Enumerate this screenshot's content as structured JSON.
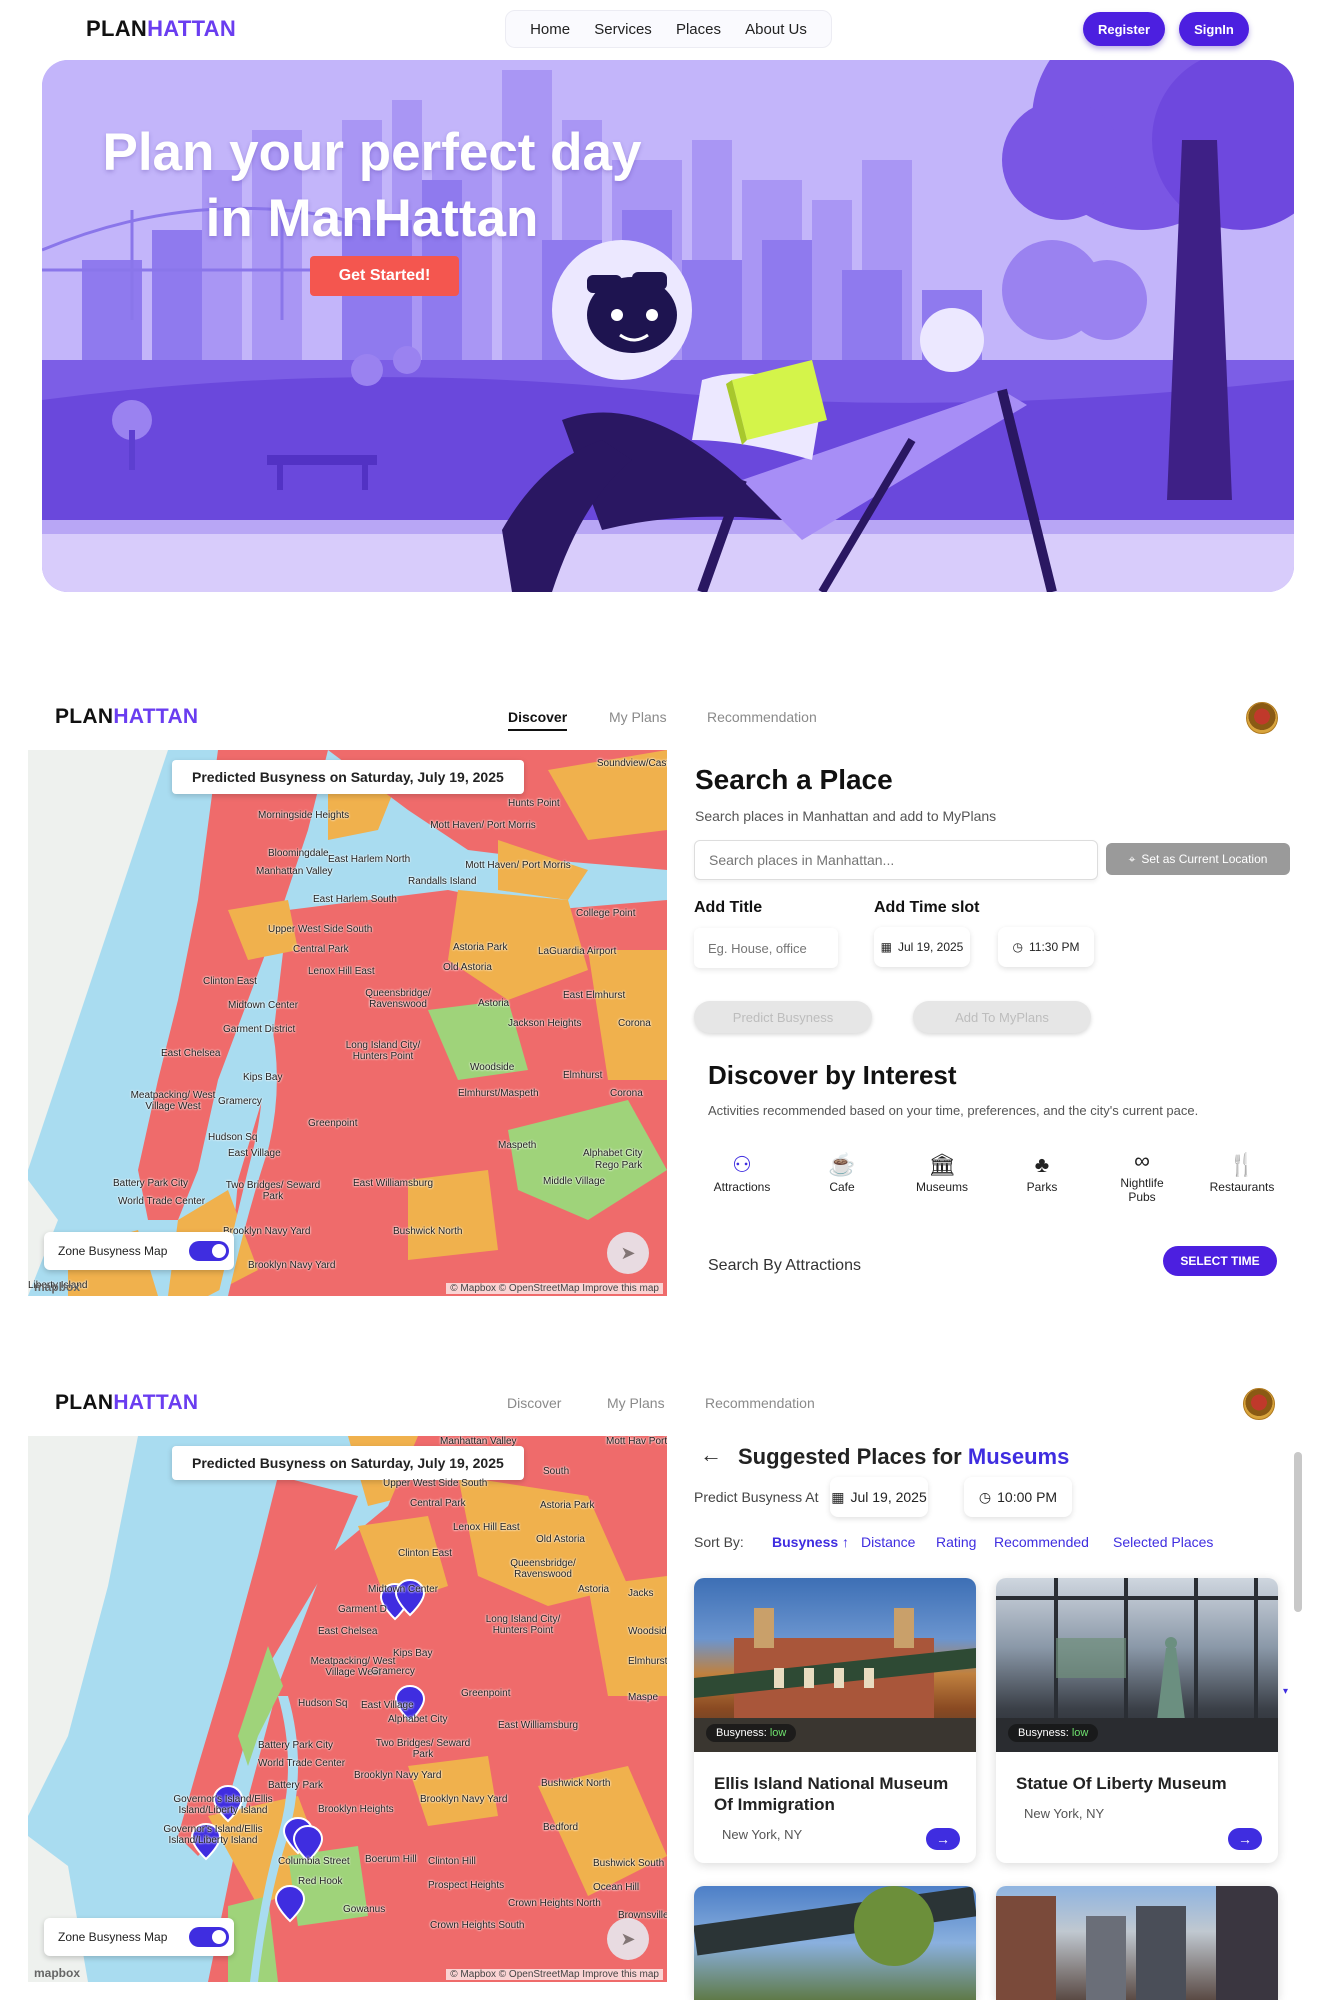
{
  "landing": {
    "logo_a": "PLAN",
    "logo_b": "HATTAN",
    "nav": [
      "Home",
      "Services",
      "Places",
      "About Us"
    ],
    "register": "Register",
    "signin": "SignIn",
    "hero_title": "Plan your perfect day in ManHattan",
    "cta": "Get Started!"
  },
  "app": {
    "logo_a": "PLAN",
    "logo_b": "HATTAN",
    "tabs": [
      "Discover",
      "My Plans",
      "Recommendation"
    ]
  },
  "map": {
    "predicted": "Predicted Busyness on Saturday, July 19, 2025",
    "zone_toggle": "Zone Busyness Map",
    "attribution": "© Mapbox © OpenStreetMap Improve this map",
    "mapbox": "mapbox",
    "labels1": [
      "Soundview/Castle Hi",
      "Hunts Point",
      "Morningside Heights",
      "Mott Haven/ Port Morris",
      "Bloomingdale",
      "East Harlem North",
      "Manhattan Valley",
      "Randalls Island",
      "Mott Haven/ Port Morris",
      "East Harlem South",
      "College Point",
      "Upper West Side South",
      "Central Park",
      "Astoria Park",
      "LaGuardia Airport",
      "Lenox Hill East",
      "Old Astoria",
      "Clinton East",
      "Queensbridge/ Ravenswood",
      "Astoria",
      "East Elmhurst",
      "Midtown Center",
      "Jackson Heights",
      "Garment District",
      "Corona",
      "Long Island City/ Hunters Point",
      "East Chelsea",
      "Woodside",
      "Elmhurst",
      "Kips Bay",
      "Meatpacking/ West Village West",
      "Gramercy",
      "Corona",
      "Elmhurst/Maspeth",
      "Greenpoint",
      "Hudson Sq",
      "East Village",
      "Alphabet City",
      "Maspeth",
      "Rego Park",
      "Middle Village",
      "Battery Park City",
      "Two Bridges/ Seward Park",
      "East Williamsburg",
      "World Trade Center",
      "Brooklyn Navy Yard",
      "Bushwick North",
      "Brooklyn Navy Yard",
      "Liberty Island"
    ],
    "labels2": [
      "Manhattan Valley",
      "Mott Hav Port Mor",
      "South",
      "Upper West Side South",
      "Central Park",
      "Astoria Park",
      "Lenox Hill East",
      "Old Astoria",
      "Clinton East",
      "Queensbridge/ Ravenswood",
      "Midtown Center",
      "Astoria",
      "Jacks",
      "Garment D",
      "East Chelsea",
      "Long Island City/ Hunters Point",
      "Woodside",
      "Kips Bay",
      "Meatpacking/ West Village West",
      "Gramercy",
      "Elmhurst",
      "Greenpoint",
      "Maspe",
      "Hudson Sq",
      "East Village",
      "Alphabet City",
      "East Williamsburg",
      "Battery Park City",
      "Two Bridges/ Seward Park",
      "World Trade Center",
      "Brooklyn Navy Yard",
      "Battery Park",
      "Bushwick North",
      "Governor's Island/Ellis Island/Liberty Island",
      "Brooklyn Navy Yard",
      "Brooklyn Heights",
      "Governor's Island/Ellis Island/Liberty Island",
      "Bedford",
      "Columbia Street",
      "Boerum Hill",
      "Clinton Hill",
      "Bushwick South",
      "Red Hook",
      "Prospect Heights",
      "Ocean Hill",
      "Gowanus",
      "Crown Heights North",
      "Crown Heights South",
      "Brownsville"
    ]
  },
  "search": {
    "title": "Search a Place",
    "subtitle": "Search places in Manhattan and add to MyPlans",
    "placeholder": "Search places in Manhattan...",
    "set_location": "Set as Current Location",
    "add_title": "Add Title",
    "title_placeholder": "Eg. House, office",
    "add_time": "Add Time slot",
    "date": "Jul 19, 2025",
    "time": "11:30 PM",
    "predict": "Predict Busyness",
    "add_plans": "Add To MyPlans"
  },
  "discover": {
    "title": "Discover by Interest",
    "subtitle": "Activities recommended based on your time, preferences, and the city's current pace.",
    "categories": [
      {
        "label": "Attractions",
        "icon": "binoculars-icon"
      },
      {
        "label": "Cafe",
        "icon": "coffee-icon"
      },
      {
        "label": "Museums",
        "icon": "museum-icon"
      },
      {
        "label": "Parks",
        "icon": "tree-icon"
      },
      {
        "label": "Nightlife Pubs",
        "icon": "glasses-icon"
      },
      {
        "label": "Restaurants",
        "icon": "utensils-icon"
      }
    ],
    "search_by": "Search By Attractions",
    "select_time": "SELECT TIME"
  },
  "suggest": {
    "title_a": "Suggested Places for",
    "title_b": "Museums",
    "predict_at": "Predict Busyness At",
    "date": "Jul 19, 2025",
    "time": "10:00 PM",
    "sort_by": "Sort By:",
    "sorts": [
      "Busyness",
      "Distance",
      "Rating",
      "Recommended",
      "Selected Places"
    ],
    "busyness_prefix": "Busyness:",
    "cards": [
      {
        "name": "Ellis Island National Museum Of Immigration",
        "loc": "New York, NY",
        "busy": "low"
      },
      {
        "name": "Statue Of Liberty Museum",
        "loc": "New York, NY",
        "busy": "low"
      }
    ]
  },
  "colors": {
    "accent": "#4c1fe0",
    "brand": "#6a3df0",
    "cta": "#f4564f",
    "busy_high": "#ef6b6b",
    "busy_mid": "#f0b14d",
    "busy_low": "#9fd37a",
    "water": "#a9dcf0"
  }
}
